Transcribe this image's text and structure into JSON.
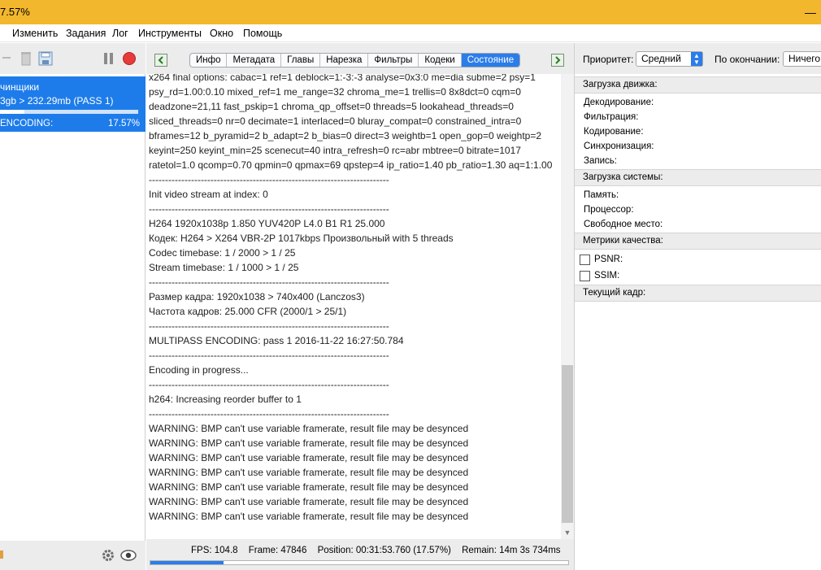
{
  "window": {
    "title": "7.57%"
  },
  "menu": [
    "Изменить",
    "Задания",
    "Лог",
    "Инструменты",
    "Окно",
    "Помощь"
  ],
  "job": {
    "name": "чинщики",
    "size": "3gb > 232.29mb (PASS 1)",
    "status": "ENCODING:",
    "percent": "17.57%",
    "progress": 0.1757
  },
  "tabs": [
    "Инфо",
    "Метадата",
    "Главы",
    "Нарезка",
    "Фильтры",
    "Кодеки",
    "Состояние"
  ],
  "active_tab": "Состояние",
  "log": [
    "x264 final options: cabac=1 ref=1 deblock=1:-3:-3 analyse=0x3:0 me=dia subme=2 psy=1",
    "psy_rd=1.00:0.10 mixed_ref=1 me_range=32 chroma_me=1 trellis=0 8x8dct=0 cqm=0",
    "deadzone=21,11 fast_pskip=1 chroma_qp_offset=0 threads=5 lookahead_threads=0",
    "sliced_threads=0 nr=0 decimate=1 interlaced=0 bluray_compat=0 constrained_intra=0",
    "bframes=12 b_pyramid=2 b_adapt=2 b_bias=0 direct=3 weightb=1 open_gop=0 weightp=2",
    "keyint=250 keyint_min=25 scenecut=40 intra_refresh=0 rc=abr mbtree=0 bitrate=1017",
    "ratetol=1.0 qcomp=0.70 qpmin=0 qpmax=69 qpstep=4 ip_ratio=1.40 pb_ratio=1.30 aq=1:1.00",
    "--------------------------------------------------------------------------",
    "Init video stream at index: 0",
    "--------------------------------------------------------------------------",
    "H264 1920x1038p 1.850 YUV420P L4.0 B1 R1 25.000",
    "Кодек: H264 > X264 VBR-2P 1017kbps Произвольный with 5 threads",
    "Codec timebase: 1 / 2000 > 1 / 25",
    "Stream timebase: 1 / 1000 > 1 / 25",
    "--------------------------------------------------------------------------",
    "Размер кадра: 1920x1038 > 740x400 (Lanczos3)",
    "Частота кадров: 25.000 CFR (2000/1 > 25/1)",
    "--------------------------------------------------------------------------",
    "MULTIPASS ENCODING: pass 1 2016-11-22 16:27:50.784",
    "--------------------------------------------------------------------------",
    "Encoding in progress...",
    "--------------------------------------------------------------------------",
    "h264: Increasing reorder buffer to 1",
    "--------------------------------------------------------------------------",
    "WARNING: BMP can't use variable framerate, result file may be desynced",
    "WARNING: BMP can't use variable framerate, result file may be desynced",
    "WARNING: BMP can't use variable framerate, result file may be desynced",
    "WARNING: BMP can't use variable framerate, result file may be desynced",
    "WARNING: BMP can't use variable framerate, result file may be desynced",
    "WARNING: BMP can't use variable framerate, result file may be desynced",
    "WARNING: BMP can't use variable framerate, result file may be desynced"
  ],
  "status": {
    "fps": "FPS: 104.8",
    "frame": "Frame: 47846",
    "position": "Position: 00:31:53.760 (17.57%)",
    "remain": "Remain: 14m 3s 734ms",
    "progress": 0.1757
  },
  "right": {
    "priority_label": "Приоритет:",
    "priority_value": "Средний",
    "on_finish_label": "По окончании:",
    "on_finish_value": "Ничего",
    "engine_head": "Загрузка движка:",
    "engine_rows": [
      "Декодирование:",
      "Фильтрация:",
      "Кодирование:",
      "Синхронизация:",
      "Запись:"
    ],
    "system_head": "Загрузка системы:",
    "system_rows": [
      "Память:",
      "Процессор:",
      "Свободное место:"
    ],
    "metrics_head": "Метрики качества:",
    "metrics": [
      "PSNR:",
      "SSIM:"
    ],
    "frame_head": "Текущий кадр:"
  },
  "colors": {
    "titlebar": "#f3b72d",
    "accent": "#2b7de9",
    "selection": "#1d7cea",
    "stop": "#e53b3b"
  }
}
